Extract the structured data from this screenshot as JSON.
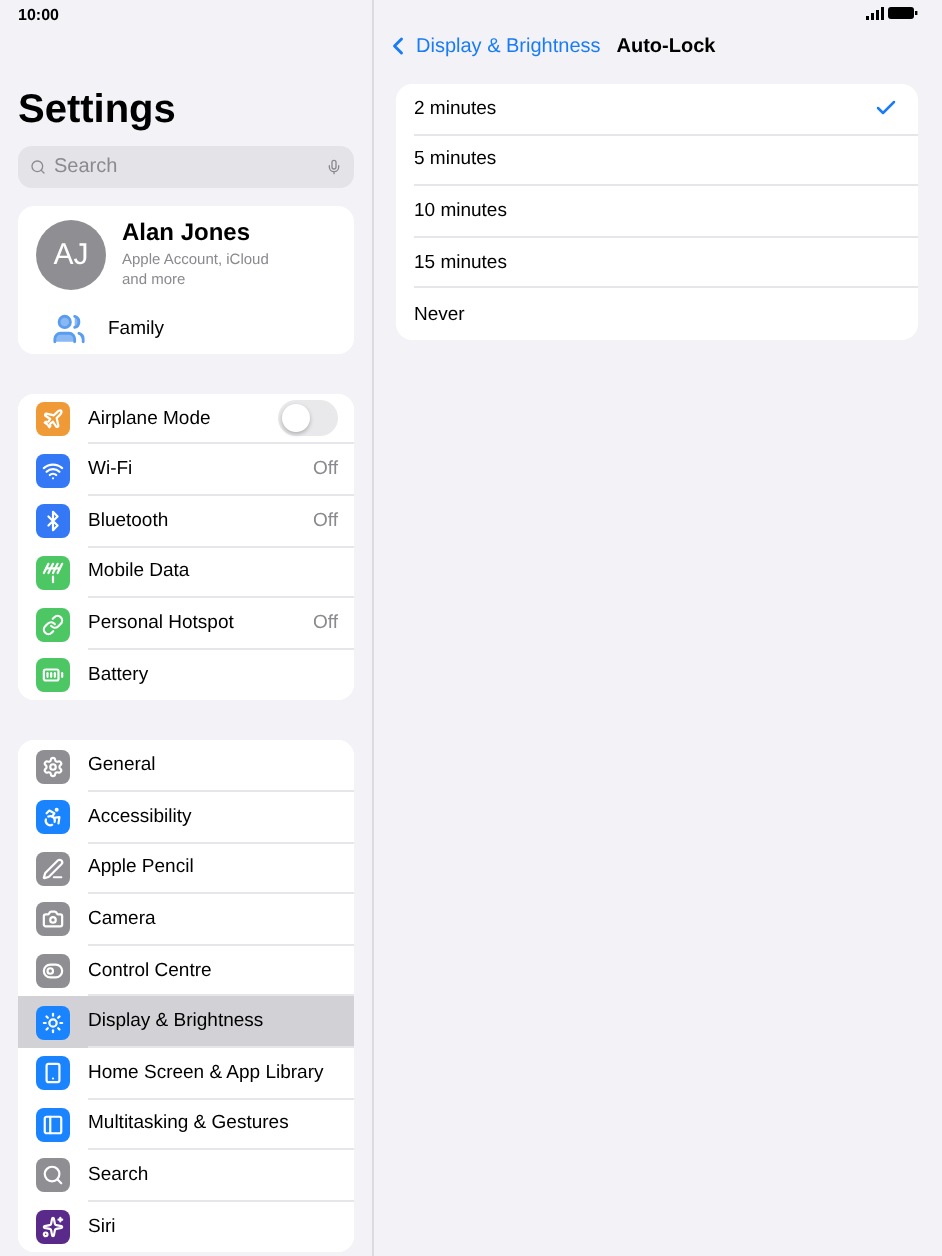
{
  "status_bar": {
    "time": "10:00"
  },
  "sidebar": {
    "title": "Settings",
    "search": {
      "placeholder": "Search"
    },
    "profile": {
      "initials": "AJ",
      "name": "Alan Jones",
      "subtitle": "Apple Account, iCloud and more",
      "family": "Family"
    },
    "groups": [
      [
        {
          "label": "Airplane Mode",
          "kind": "toggle",
          "on": false,
          "color": "#f09a37",
          "selected": false
        },
        {
          "label": "Wi-Fi",
          "kind": "value",
          "value": "Off",
          "color": "#3478f6",
          "selected": false
        },
        {
          "label": "Bluetooth",
          "kind": "value",
          "value": "Off",
          "color": "#3478f6",
          "selected": false
        },
        {
          "label": "Mobile Data",
          "kind": "plain",
          "color": "#4cc764",
          "selected": false
        },
        {
          "label": "Personal Hotspot",
          "kind": "value",
          "value": "Off",
          "color": "#4cc764",
          "selected": false
        },
        {
          "label": "Battery",
          "kind": "plain",
          "color": "#4cc764",
          "selected": false
        }
      ],
      [
        {
          "label": "General",
          "kind": "plain",
          "color": "#8e8e93",
          "selected": false
        },
        {
          "label": "Accessibility",
          "kind": "plain",
          "color": "#1a84ff",
          "selected": false
        },
        {
          "label": "Apple Pencil",
          "kind": "plain",
          "color": "#8e8e93",
          "selected": false
        },
        {
          "label": "Camera",
          "kind": "plain",
          "color": "#8e8e93",
          "selected": false
        },
        {
          "label": "Control Centre",
          "kind": "plain",
          "color": "#8e8e93",
          "selected": false
        },
        {
          "label": "Display & Brightness",
          "kind": "plain",
          "color": "#1a84ff",
          "selected": true
        },
        {
          "label": "Home Screen & App Library",
          "kind": "plain",
          "color": "#1a84ff",
          "selected": false
        },
        {
          "label": "Multitasking & Gestures",
          "kind": "plain",
          "color": "#1a84ff",
          "selected": false
        },
        {
          "label": "Search",
          "kind": "plain",
          "color": "#8e8e93",
          "selected": false
        },
        {
          "label": "Siri",
          "kind": "plain",
          "color": "#5a2a8a",
          "selected": false
        }
      ]
    ]
  },
  "detail": {
    "back": "Display & Brightness",
    "title": "Auto-Lock",
    "options": [
      {
        "label": "2 minutes",
        "selected": true
      },
      {
        "label": "5 minutes",
        "selected": false
      },
      {
        "label": "10 minutes",
        "selected": false
      },
      {
        "label": "15 minutes",
        "selected": false
      },
      {
        "label": "Never",
        "selected": false
      }
    ]
  }
}
